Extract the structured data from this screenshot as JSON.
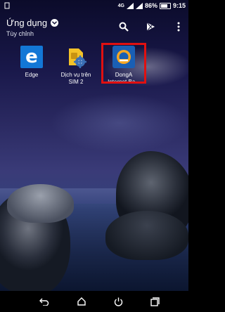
{
  "status_bar": {
    "network": "4G",
    "battery_percent": "86%",
    "time": "9:15"
  },
  "header": {
    "title": "Ứng dụng",
    "subtitle": "Tùy chỉnh"
  },
  "apps": [
    {
      "label_line1": "Edge",
      "label_line2": "",
      "icon": "edge-icon"
    },
    {
      "label_line1": "Dịch vụ trên",
      "label_line2": "SIM 2",
      "icon": "sim-services-icon"
    },
    {
      "label_line1": "DongA",
      "label_line2": "Internet Ba...",
      "icon": "donga-bank-icon",
      "highlighted": true
    }
  ],
  "nav": {
    "buttons": [
      "back",
      "home",
      "power",
      "recent-apps"
    ]
  },
  "colors": {
    "highlight": "#e01010",
    "edge_blue": "#1377d6",
    "donga_blue": "#1a5fb4"
  }
}
